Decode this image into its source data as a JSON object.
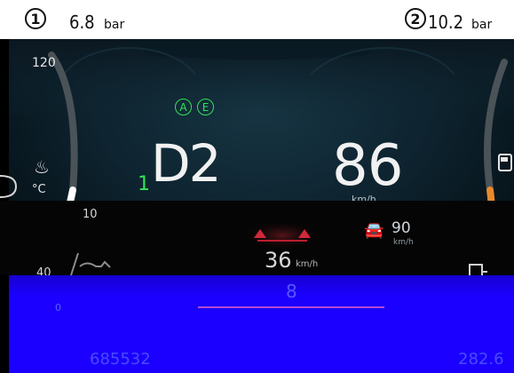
{
  "top": {
    "left_circle": "1",
    "left_value": "6.8",
    "left_unit": "bar",
    "right_circle": "2",
    "right_value": "10.2",
    "right_unit": "bar"
  },
  "left_gauge": {
    "top_label": "120",
    "temp_unit": "°C",
    "scale_10": "10",
    "scale_40": "40"
  },
  "center": {
    "badge_a": "A",
    "badge_e": "E",
    "gear_prefix": "1",
    "gear": "D2",
    "speed": "86",
    "speed_unit": "km/h"
  },
  "lower": {
    "limit_speed": "36",
    "limit_unit": "km/h",
    "cruise_value": "90",
    "cruise_unit": "km/h"
  },
  "bottom": {
    "odometer": "685532",
    "trip": "282.6",
    "center_digit": "8",
    "small_zero": "0"
  },
  "colors": {
    "green": "#2fe45a",
    "blue_panel": "#1b00ff",
    "orange": "#e88a2d",
    "red": "#9b2a13"
  }
}
